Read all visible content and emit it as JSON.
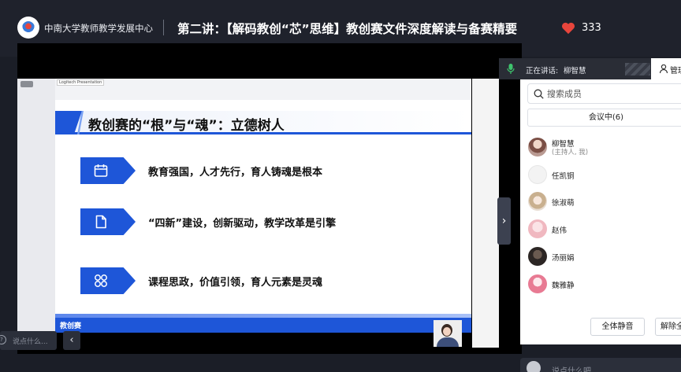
{
  "header": {
    "org_name": "中南大学教师教学发展中心",
    "title": "第二讲：【解码教创“芯”思维】教创赛文件深度解读与备赛精要",
    "likes": "333"
  },
  "stage": {
    "app_tag": "Logitech Presentation",
    "slide": {
      "title": "教创赛的“根”与“魂”：立德树人",
      "items": [
        {
          "icon": "calendar-icon",
          "text": "教育强国，人才先行，育人铸魂是根本"
        },
        {
          "icon": "document-icon",
          "text": "“四新”建设，创新驱动，教学改革是引擎"
        },
        {
          "icon": "grid-icon",
          "text": "课程思政，价值引领，育人元素是灵魂"
        }
      ],
      "footer_label": "教创赛"
    }
  },
  "chat_left": {
    "placeholder": "说点什么...",
    "help": "?"
  },
  "speaking": {
    "label": "正在讲话:",
    "name": "柳智慧"
  },
  "manage_tab": {
    "label": "管理"
  },
  "members": {
    "search_placeholder": "搜索成员",
    "in_meeting_label": "会议中(6)",
    "list": [
      {
        "name": "柳智慧",
        "role": "(主持人, 我)"
      },
      {
        "name": "任凯铜"
      },
      {
        "name": "徐淑萌"
      },
      {
        "name": "赵伟"
      },
      {
        "name": "汤丽娟"
      },
      {
        "name": "魏雅静"
      }
    ],
    "mute_all": "全体静音",
    "unmute_all": "解除全体静音"
  },
  "chat_bottom": {
    "placeholder": "说点什么吧"
  },
  "colors": {
    "accent": "#1e56d8",
    "heart": "#e8453c"
  }
}
